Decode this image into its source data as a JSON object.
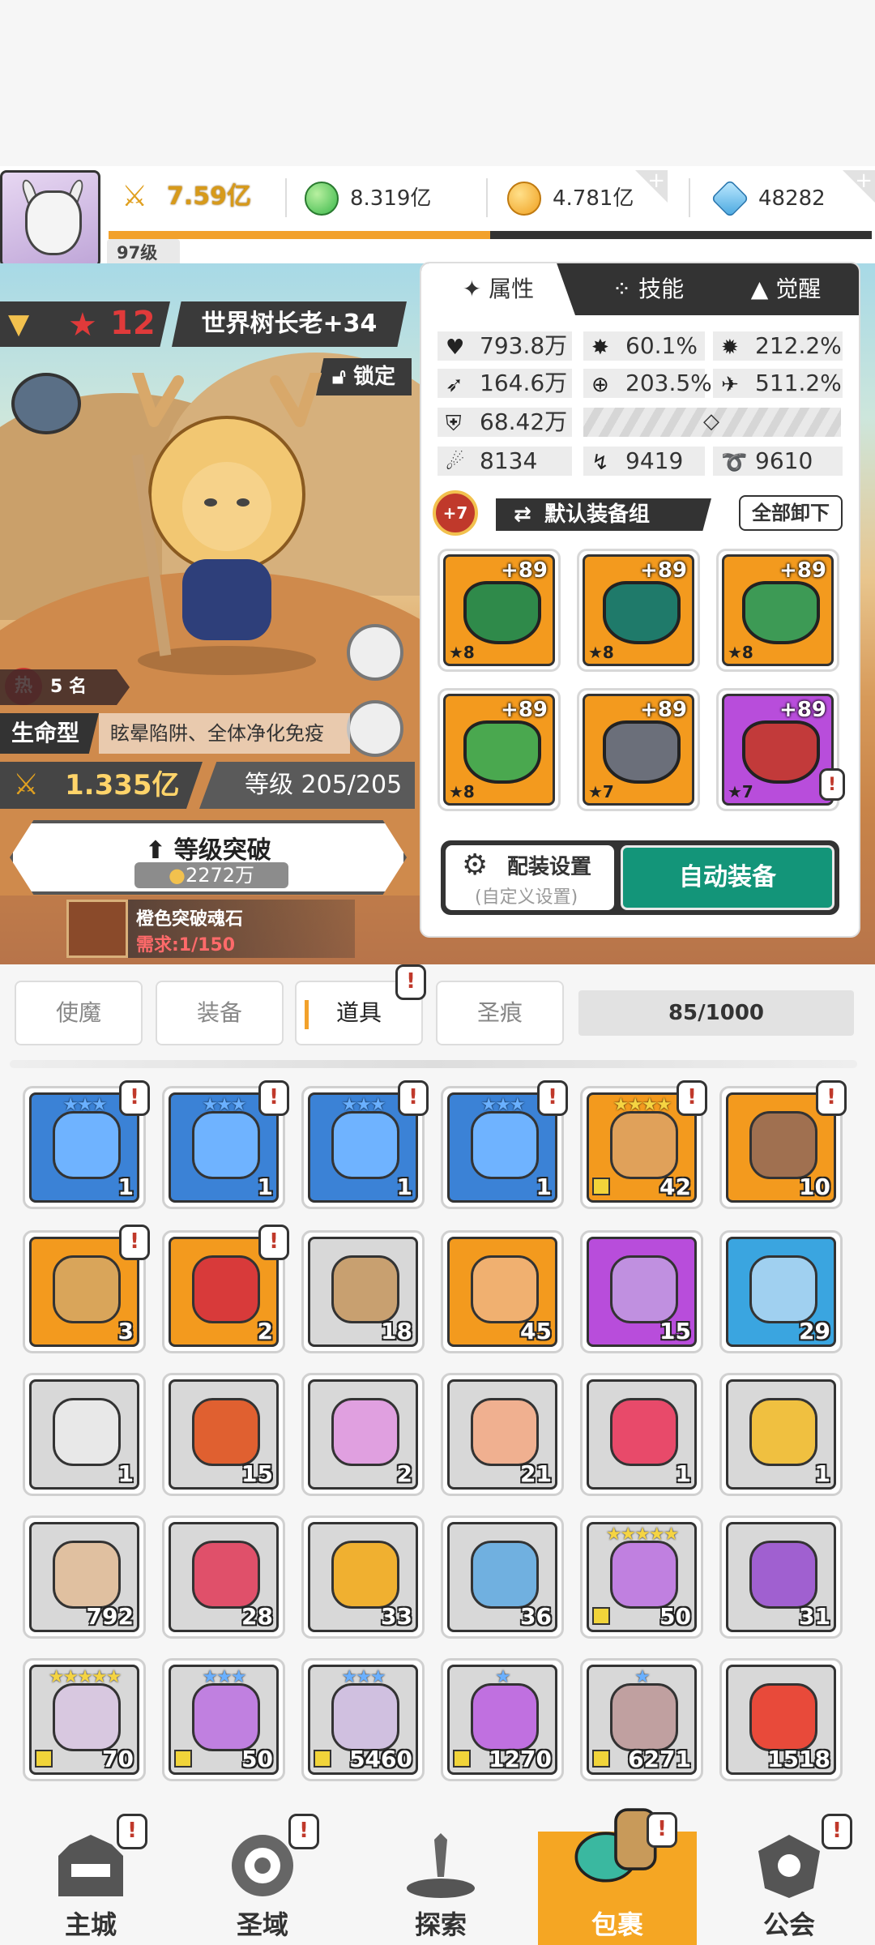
{
  "player": {
    "level": "97级",
    "xp_fraction": 0.5
  },
  "resources": {
    "power": "7.59亿",
    "green": "8.319亿",
    "gold": "4.781亿",
    "gem": "48282"
  },
  "hero": {
    "stars": "12",
    "name": "世界树长老+34",
    "lock_label": "锁定",
    "hot_rank": "5 名",
    "hot_icon": "热",
    "type": "生命型",
    "traits": "眩晕陷阱、全体净化免疫",
    "power": "1.335亿",
    "level": "等级 205/205",
    "breakthrough_label": "等级突破",
    "breakthrough_cost": "2272万",
    "stone_name": "橙色突破魂石",
    "stone_need": "需求:1/150"
  },
  "panel": {
    "tabs": [
      {
        "label": "属性"
      },
      {
        "label": "技能"
      },
      {
        "label": "觉醒"
      }
    ],
    "stats": [
      "793.8万",
      "60.1%",
      "212.2%",
      "164.6万",
      "203.5%",
      "511.2%",
      "68.42万",
      "8134",
      "9419",
      "9610"
    ],
    "equip_group_badge": "+7",
    "equip_group": "默认装备组",
    "unequip_all": "全部卸下",
    "equipment": [
      {
        "enh": "+89",
        "star": "★8",
        "color": "#f39a1e",
        "gem": "#2f8a4a"
      },
      {
        "enh": "+89",
        "star": "★8",
        "color": "#f39a1e",
        "gem": "#1f7a6a"
      },
      {
        "enh": "+89",
        "star": "★8",
        "color": "#f39a1e",
        "gem": "#3d9a55"
      },
      {
        "enh": "+89",
        "star": "★8",
        "color": "#f39a1e",
        "gem": "#4aa84f"
      },
      {
        "enh": "+89",
        "star": "★7",
        "color": "#f39a1e",
        "gem": "#6b6f7a"
      },
      {
        "enh": "+89",
        "star": "★7",
        "color": "#b84ddb",
        "gem": "#c23a3a"
      }
    ],
    "config_label": "配装设置",
    "config_sub": "(自定义设置)",
    "auto_equip": "自动装备"
  },
  "bag": {
    "tabs": [
      {
        "label": "使魔"
      },
      {
        "label": "装备"
      },
      {
        "label": "道具"
      },
      {
        "label": "圣痕"
      }
    ],
    "capacity": "85/1000",
    "items": [
      {
        "count": "1",
        "bg": "#3b82d6",
        "color": "#6fb3ff",
        "stars": "★★★",
        "alert": true
      },
      {
        "count": "1",
        "bg": "#3b82d6",
        "color": "#6fb3ff",
        "stars": "★★★",
        "alert": true
      },
      {
        "count": "1",
        "bg": "#3b82d6",
        "color": "#6fb3ff",
        "stars": "★★★",
        "alert": true
      },
      {
        "count": "1",
        "bg": "#3b82d6",
        "color": "#6fb3ff",
        "stars": "★★★",
        "alert": true
      },
      {
        "count": "42",
        "bg": "#f39a1e",
        "color": "#e0a15a",
        "stars": "★★★★",
        "alert": true,
        "mark": true
      },
      {
        "count": "10",
        "bg": "#f39a1e",
        "color": "#a07050",
        "stars": "",
        "alert": true
      },
      {
        "count": "3",
        "bg": "#f39a1e",
        "color": "#d9a55a",
        "stars": "",
        "alert": true
      },
      {
        "count": "2",
        "bg": "#f39a1e",
        "color": "#d83a3a",
        "stars": "",
        "alert": true
      },
      {
        "count": "18",
        "bg": "#d8d8d8",
        "color": "#c8a070",
        "stars": ""
      },
      {
        "count": "45",
        "bg": "#f39a1e",
        "color": "#f0b070",
        "stars": ""
      },
      {
        "count": "15",
        "bg": "#b84ddb",
        "color": "#c090e0",
        "stars": ""
      },
      {
        "count": "29",
        "bg": "#3aa5e0",
        "color": "#a0d0f0",
        "stars": ""
      },
      {
        "count": "1",
        "bg": "#d8d8d8",
        "color": "#e8e8e8",
        "stars": ""
      },
      {
        "count": "15",
        "bg": "#d8d8d8",
        "color": "#e06030",
        "stars": ""
      },
      {
        "count": "2",
        "bg": "#d8d8d8",
        "color": "#e0a0e0",
        "stars": ""
      },
      {
        "count": "21",
        "bg": "#d8d8d8",
        "color": "#f0b090",
        "stars": ""
      },
      {
        "count": "1",
        "bg": "#d8d8d8",
        "color": "#e84a6a",
        "stars": ""
      },
      {
        "count": "1",
        "bg": "#d8d8d8",
        "color": "#f0c040",
        "stars": ""
      },
      {
        "count": "792",
        "bg": "#d8d8d8",
        "color": "#e0c0a0",
        "stars": ""
      },
      {
        "count": "28",
        "bg": "#d8d8d8",
        "color": "#e0506a",
        "stars": ""
      },
      {
        "count": "33",
        "bg": "#d8d8d8",
        "color": "#f0b030",
        "stars": ""
      },
      {
        "count": "36",
        "bg": "#d8d8d8",
        "color": "#70b0e0",
        "stars": ""
      },
      {
        "count": "50",
        "bg": "#d8d8d8",
        "color": "#c080e0",
        "stars": "★★★★★",
        "mark": true
      },
      {
        "count": "31",
        "bg": "#d8d8d8",
        "color": "#a060d0",
        "stars": ""
      },
      {
        "count": "70",
        "bg": "#d8d8d8",
        "color": "#d8c8e0",
        "stars": "★★★★★",
        "mark": true
      },
      {
        "count": "50",
        "bg": "#d8d8d8",
        "color": "#c080e0",
        "stars": "★★★",
        "mark": true
      },
      {
        "count": "5460",
        "bg": "#d8d8d8",
        "color": "#d0c0e0",
        "stars": "★★★",
        "mark": true
      },
      {
        "count": "1270",
        "bg": "#d8d8d8",
        "color": "#c070e0",
        "stars": "★",
        "mark": true
      },
      {
        "count": "6271",
        "bg": "#d8d8d8",
        "color": "#c0a0a0",
        "stars": "★",
        "mark": true
      },
      {
        "count": "1518",
        "bg": "#d8d8d8",
        "color": "#e84a3a",
        "stars": ""
      }
    ]
  },
  "nav": [
    {
      "label": "主城",
      "icon": "castle-icon"
    },
    {
      "label": "圣域",
      "icon": "vortex-icon"
    },
    {
      "label": "探索",
      "icon": "sword-icon"
    },
    {
      "label": "包裹",
      "icon": "bag-icon"
    },
    {
      "label": "公会",
      "icon": "guild-icon"
    }
  ]
}
